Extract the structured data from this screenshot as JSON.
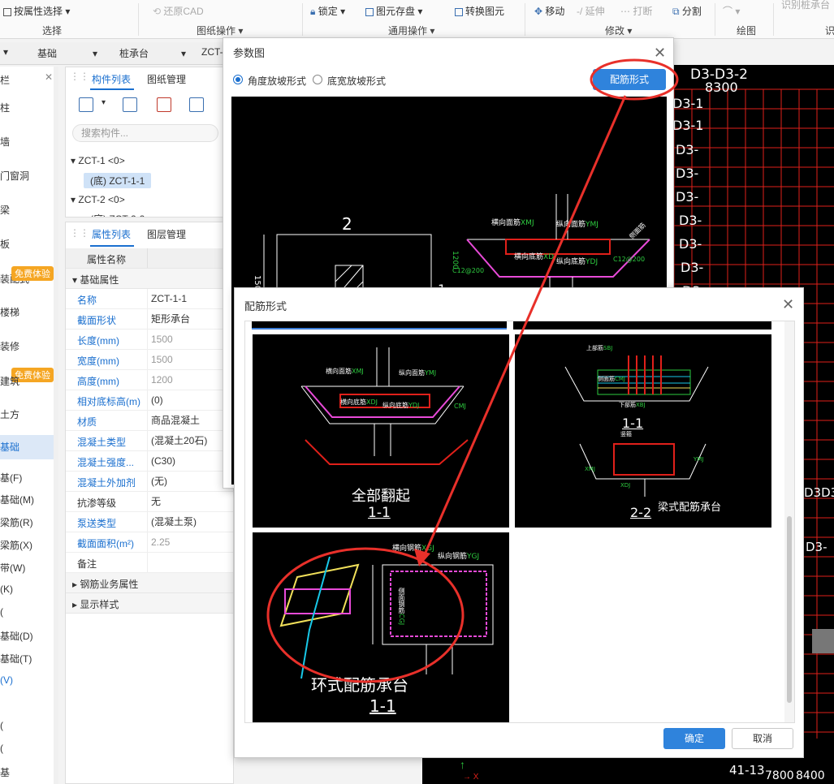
{
  "ribbon": {
    "items": [
      {
        "label": "按属性选择",
        "disabled": false
      },
      {
        "label": "还原CAD",
        "disabled": true
      },
      {
        "label": "锁定",
        "disabled": false
      },
      {
        "label": "图元存盘",
        "disabled": false
      },
      {
        "label": "转换图元",
        "disabled": false
      },
      {
        "label": "移动",
        "disabled": false
      },
      {
        "label": "延伸",
        "disabled": true
      },
      {
        "label": "打断",
        "disabled": true
      },
      {
        "label": "分割",
        "disabled": false
      },
      {
        "label": "识别桩承台",
        "disabled": true
      }
    ],
    "groups": [
      "选择",
      "图纸操作",
      "通用操作",
      "修改",
      "绘图",
      "识"
    ]
  },
  "selectors": {
    "first": "基础",
    "second": "桩承台",
    "third": "ZCT-"
  },
  "left_nav": {
    "header": "栏",
    "items": [
      "柱",
      "墙",
      "门窗洞",
      "梁",
      "板",
      "装配式",
      "楼梯",
      "装修",
      "土方",
      "基础",
      "基(F)",
      "基础(M)",
      "梁筋(R)",
      "梁筋(X)",
      "带(W)",
      "(K)",
      "(",
      "基础(D)",
      "基础(T)",
      "(V)",
      "(",
      "(",
      "基"
    ],
    "badge1": "免费体验",
    "badge2": "免费体验",
    "item_extra_a": "装配式",
    "item_extra_b": "建筑"
  },
  "component_panel": {
    "tabs": [
      "构件列表",
      "图纸管理"
    ],
    "search_placeholder": "搜索构件...",
    "tree": [
      "ZCT-1 <0>",
      "(底) ZCT-1-1",
      "ZCT-2 <0>",
      "(底) ZCT-2-2"
    ]
  },
  "properties_panel": {
    "tabs": [
      "属性列表",
      "图层管理"
    ],
    "header_name": "属性名称",
    "section_basic": "基础属性",
    "rows": [
      {
        "name": "名称",
        "value": "ZCT-1-1",
        "blue": true,
        "gray": false
      },
      {
        "name": "截面形状",
        "value": "矩形承台",
        "blue": true,
        "gray": false
      },
      {
        "name": "长度(mm)",
        "value": "1500",
        "blue": true,
        "gray": true
      },
      {
        "name": "宽度(mm)",
        "value": "1500",
        "blue": true,
        "gray": true
      },
      {
        "name": "高度(mm)",
        "value": "1200",
        "blue": true,
        "gray": true
      },
      {
        "name": "相对底标高(m)",
        "value": "(0)",
        "blue": true,
        "gray": false
      },
      {
        "name": "材质",
        "value": "商品混凝土",
        "blue": true,
        "gray": false
      },
      {
        "name": "混凝土类型",
        "value": "(混凝土20石)",
        "blue": true,
        "gray": false
      },
      {
        "name": "混凝土强度...",
        "value": "(C30)",
        "blue": true,
        "gray": false
      },
      {
        "name": "混凝土外加剂",
        "value": "(无)",
        "blue": true,
        "gray": false
      },
      {
        "name": "抗渗等级",
        "value": "无",
        "blue": false,
        "gray": false
      },
      {
        "name": "泵送类型",
        "value": "(混凝土泵)",
        "blue": true,
        "gray": false
      },
      {
        "name": "截面面积(m²)",
        "value": "2.25",
        "blue": true,
        "gray": true
      },
      {
        "name": "备注",
        "value": "",
        "blue": false,
        "gray": false
      }
    ],
    "section_rebar": "钢筋业务属性",
    "section_display": "显示样式"
  },
  "param_dialog": {
    "title": "参数图",
    "radio1": "角度放坡形式",
    "radio2": "底宽放坡形式",
    "button": "配筋形式",
    "drawing": {
      "label_top": "2",
      "label_side": "1500",
      "label_mid": "1",
      "h1": "横向面筋",
      "h1c": "XMJ",
      "h2": "纵向面筋",
      "h2c": "YMJ",
      "h3": "横向底筋",
      "h3c": "XDJ",
      "h4": "纵向底筋",
      "h4c": "YDJ",
      "dim": "1200",
      "c1": "C12@200",
      "c2": "C12@200",
      "side": "侧面筋"
    }
  },
  "rebar_dialog": {
    "title": "配筋形式",
    "options": [
      {
        "label": "全部翻起",
        "section": "1-1"
      },
      {
        "label": "梁式配筋承台",
        "section1": "1-1",
        "section2": "2-2"
      },
      {
        "label": "环式配筋承台",
        "section": "1-1"
      }
    ],
    "thumb_text": {
      "a1": "横向面筋",
      "a1c": "XMJ",
      "a2": "纵向面筋",
      "a2c": "YMJ",
      "a3": "横向底筋",
      "a3c": "XDJ",
      "a4": "纵向底筋",
      "a4c": "YDJ",
      "a5": "CMJ",
      "b1": "上部筋",
      "b1c": "SBJ",
      "b2": "下部筋",
      "b2c": "XBJ",
      "b3": "侧面筋",
      "b3c": "CMJ",
      "b4": "竖箍",
      "b5": "XMJ",
      "b6": "YMJ",
      "b7": "XDJ",
      "c1": "横向钢筋",
      "c1c": "XGJ",
      "c2": "纵向钢筋",
      "c2c": "YGJ",
      "c3": "侧面钢筋",
      "c3c": "CGJ"
    },
    "ok": "确定",
    "cancel": "取消"
  },
  "cad_labels": [
    "D3-D3-2",
    "8300",
    "D3-1",
    "D3-1",
    "D3-",
    "D3-",
    "D3-",
    "D3-",
    "D3-",
    "D3-",
    "D3-",
    "D3-",
    "D3D3",
    "D3-",
    "41-13",
    "7800",
    "8400"
  ],
  "colors": {
    "accent": "#2f83dc",
    "annotation": "#e8302a",
    "cad_grid": "#e0201a"
  }
}
